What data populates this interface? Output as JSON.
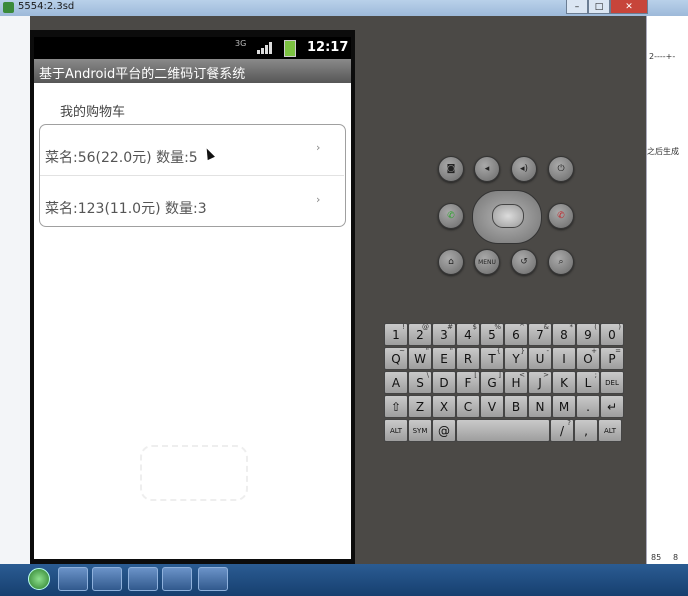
{
  "window": {
    "title": "5554:2.3sd"
  },
  "phone": {
    "status": {
      "time": "12:17",
      "data_indicator": "3G"
    },
    "app_title": "基于Android平台的二维码订餐系统",
    "list_header": "我的购物车",
    "cart_items": [
      {
        "label": "菜名:56(22.0元) 数量:5",
        "chevron": "›"
      },
      {
        "label": "菜名:123(11.0元) 数量:3",
        "chevron": "›"
      }
    ]
  },
  "controls": {
    "menu_label": "MENU",
    "icons": [
      "camera-icon",
      "volume-down-icon",
      "volume-up-icon",
      "power-icon",
      "call-icon",
      "end-call-icon",
      "home-icon",
      "menu-icon",
      "back-icon",
      "search-icon"
    ]
  },
  "keyboard": {
    "row1": [
      [
        "1",
        "!"
      ],
      [
        "2",
        "@"
      ],
      [
        "3",
        "#"
      ],
      [
        "4",
        "$"
      ],
      [
        "5",
        "%"
      ],
      [
        "6",
        "^"
      ],
      [
        "7",
        "&"
      ],
      [
        "8",
        "*"
      ],
      [
        "9",
        "("
      ],
      [
        "0",
        ")"
      ]
    ],
    "row2": [
      [
        "Q",
        "~"
      ],
      [
        "W",
        "\""
      ],
      [
        "E",
        "\""
      ],
      [
        "R",
        ""
      ],
      [
        "T",
        "{"
      ],
      [
        "Y",
        "}"
      ],
      [
        "U",
        "-"
      ],
      [
        "I",
        ""
      ],
      [
        "O",
        "+"
      ],
      [
        "P",
        "="
      ]
    ],
    "row3": [
      [
        "A",
        ""
      ],
      [
        "S",
        "\\"
      ],
      [
        "D",
        ""
      ],
      [
        "F",
        "["
      ],
      [
        "G",
        "]"
      ],
      [
        "H",
        "<"
      ],
      [
        "J",
        ">"
      ],
      [
        "K",
        ""
      ],
      [
        "L",
        ";"
      ],
      [
        "DEL",
        ""
      ]
    ],
    "row4": [
      [
        "⇧",
        ""
      ],
      [
        "Z",
        ""
      ],
      [
        "X",
        ""
      ],
      [
        "C",
        ""
      ],
      [
        "V",
        ""
      ],
      [
        "B",
        ""
      ],
      [
        "N",
        ""
      ],
      [
        "M",
        ""
      ],
      [
        ".",
        ""
      ],
      [
        "↵",
        ""
      ]
    ],
    "row5": [
      [
        "ALT",
        ""
      ],
      [
        "SYM",
        ""
      ],
      [
        "@",
        ""
      ],
      [
        "",
        ""
      ],
      [
        "/",
        "?"
      ],
      [
        ",",
        ""
      ],
      [
        "ALT",
        ""
      ]
    ]
  },
  "background": {
    "right_text": "之后生成",
    "right_numbers": [
      "85",
      "8"
    ],
    "dashes": "2----+-"
  },
  "colors": {
    "titlebar_gray": "#6f6f6f",
    "battery_green": "#7cc242",
    "call_green": "#2aa22a",
    "end_red": "#c0262a"
  }
}
